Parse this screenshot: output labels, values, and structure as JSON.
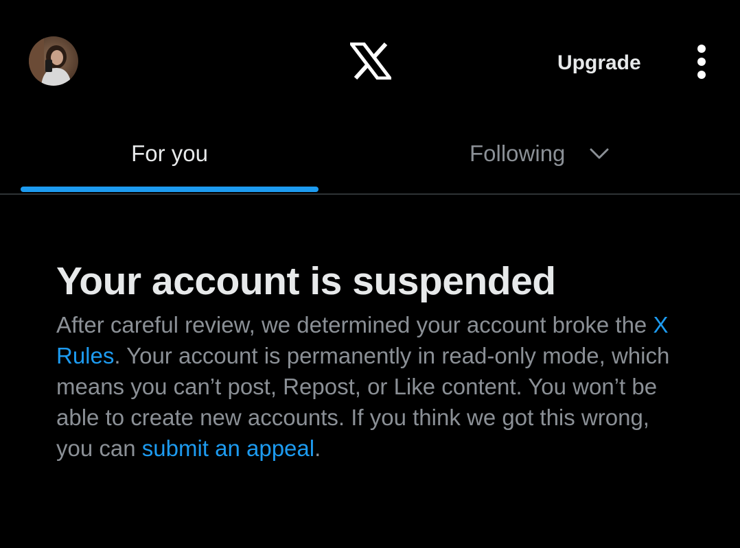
{
  "header": {
    "avatar_icon": "user-avatar",
    "logo_icon": "x-logo-icon",
    "upgrade_label": "Upgrade",
    "more_icon": "vertical-dots-icon"
  },
  "tabs": [
    {
      "label": "For you",
      "selected": true
    },
    {
      "label": "Following",
      "selected": false,
      "icon": "chevron-down-icon"
    }
  ],
  "notice": {
    "title": "Your account is suspended",
    "body_part1": "After careful review, we determined your account broke the ",
    "rules_link": "X Rules",
    "body_part2": ". Your account is permanently in read-only mode, which means you can’t post, Repost, or Like content. You won’t be able to create new accounts. If you think we got this wrong, you can ",
    "appeal_link": "submit an appeal",
    "body_end": "."
  },
  "colors": {
    "background": "#000000",
    "text_primary": "#e7e9ea",
    "text_secondary": "#8b9096",
    "accent": "#1d9bf0",
    "divider": "#2f3336"
  }
}
